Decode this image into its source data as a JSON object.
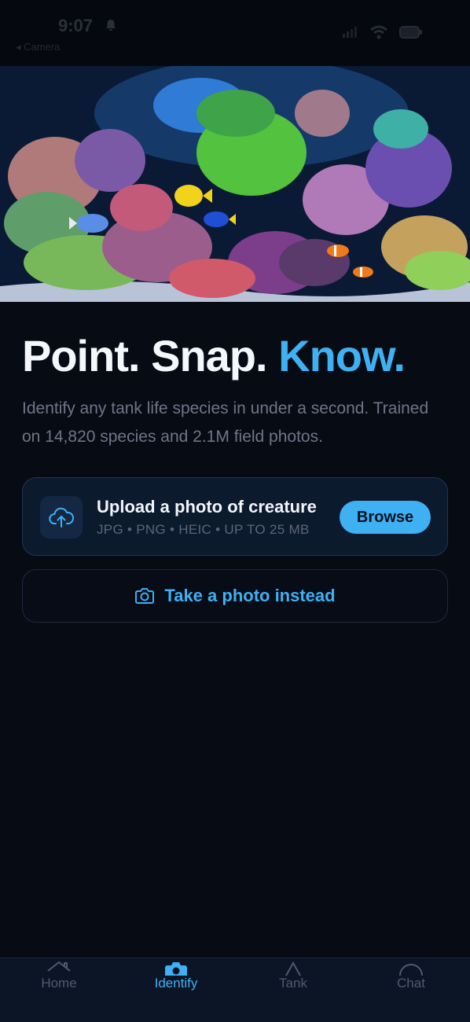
{
  "status_bar": {
    "time": "9:07",
    "back_label": "◂ Camera"
  },
  "hero": {
    "image_alt": "reef aquarium with corals and fish"
  },
  "headline": {
    "part1": "Point. Snap.",
    "accent": "Know."
  },
  "subtitle": "Identify any tank life species in under a second. Trained on 14,820 species and 2.1M field photos.",
  "upload": {
    "icon": "cloud-upload-icon",
    "title": "Upload a photo of creature",
    "formats": "JPG • PNG • HEIC • UP TO 25 MB",
    "browse_label": "Browse"
  },
  "camera": {
    "icon": "camera-icon",
    "label": "Take a photo instead"
  },
  "tabs": [
    {
      "label": "Home",
      "icon": "home-icon",
      "active": false
    },
    {
      "label": "Identify",
      "icon": "camera-icon",
      "active": true
    },
    {
      "label": "Tank",
      "icon": "tank-icon",
      "active": false
    },
    {
      "label": "Chat",
      "icon": "chat-icon",
      "active": false
    }
  ],
  "colors": {
    "background": "#070b14",
    "accent": "#3fb0f2",
    "card": "#0c1a2e",
    "muted_text": "#6d7687"
  }
}
